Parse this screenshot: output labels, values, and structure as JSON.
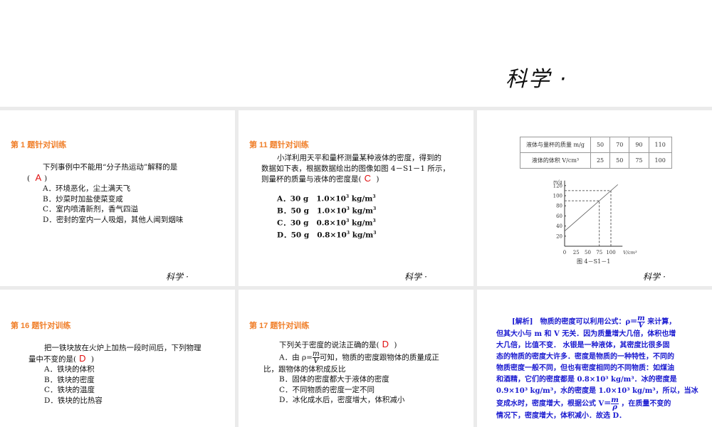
{
  "header": {
    "brand": "科学 ·"
  },
  "footer_brand": "科学 ·",
  "q1": {
    "title": "第 1 题针对训练",
    "stem": "下列事例中不能用“分子热运动”解释的是",
    "answer": "A",
    "options": [
      "A．环境恶化，尘土满天飞",
      "B．炒菜时加盐使菜变咸",
      "C．室内喷清新剂，香气四溢",
      "D．密封的室内一人吸烟，其他人闻到烟味"
    ]
  },
  "q11": {
    "title": "第 11 题针对训练",
    "stem1": "小洋利用天平和量杯测量某种液体的密度，得到的",
    "stem2": "数据如下表，根据数据绘出的图像如图 4－S1－1 所示，",
    "stem3": "则量杯的质量与液体的密度是(",
    "answer": "C",
    "close": ")",
    "options": [
      {
        "label": "A．30 g",
        "val": "1.0×10",
        "unit": "kg/m"
      },
      {
        "label": "B．50 g",
        "val": "1.0×10",
        "unit": "kg/m"
      },
      {
        "label": "C．30 g",
        "val": "0.8×10",
        "unit": "kg/m"
      },
      {
        "label": "D．50 g",
        "val": "0.8×10",
        "unit": "kg/m"
      }
    ],
    "exp": "3"
  },
  "table": {
    "row1_label": "液体与量杯的质量 m/g",
    "row1": [
      "50",
      "70",
      "90",
      "110"
    ],
    "row2_label": "液体的体积 V/cm³",
    "row2": [
      "25",
      "50",
      "75",
      "100"
    ]
  },
  "chart_data": {
    "type": "line",
    "caption": "图 4－S1－1",
    "xlabel": "V/cm³",
    "ylabel": "m/g",
    "x_ticks": [
      "0",
      "25",
      "50",
      "75",
      "100"
    ],
    "y_ticks": [
      "20",
      "40",
      "60",
      "80",
      "100",
      "120"
    ],
    "xlim": [
      0,
      125
    ],
    "ylim": [
      0,
      130
    ],
    "line": {
      "x": [
        0,
        115
      ],
      "y": [
        30,
        122
      ]
    },
    "guides": [
      {
        "x": 75,
        "y": 90
      },
      {
        "x": 100,
        "y": 110
      }
    ]
  },
  "q16": {
    "title": "第 16 题针对训练",
    "stem1": "把一铁块放在火炉上加热一段时间后，下列物理",
    "stem2": "量中不变的是(",
    "answer": "D",
    "close": ")",
    "options": [
      "A．铁块的体积",
      "B．铁块的密度",
      "C．铁块的温度",
      "D．铁块的比热容"
    ]
  },
  "q17": {
    "title": "第 17 题针对训练",
    "stem": "下列关于密度的说法正确的是(",
    "answer": "D",
    "close": ")",
    "optA1": "A．由 ρ=",
    "frac_num": "m",
    "frac_den": "V",
    "optA2": "可知，物质的密度跟物体的质量成正",
    "optA3": "比，跟物体的体积成反比",
    "options": [
      "B．固体的密度都大于液体的密度",
      "C．不同物质的密度一定不同",
      "D．冰化成水后，密度增大，体积减小"
    ]
  },
  "analysis": {
    "l1a": "[解析]　物质的密度可以利用公式：ρ＝",
    "l1b": "来计算，",
    "l2": "但其大小与 m 和 V 无关．因为质量增大几倍，体积也增",
    "l3": "大几倍，比值不变． 水银是一种液体，其密度比很多固",
    "l4": "态的物质的密度大许多．密度是物质的一种特性，不同的",
    "l5": "物质密度一般不同，但也有密度相同的不同物质：如煤油",
    "l6": "和酒精，它们的密度都是 0.8×10³ kg/m³．冰的密度是",
    "l7": "0.9×10³ kg/m³，水的密度是 1.0×10³ kg/m³，所以，当冰",
    "l8a": "变成水时，密度增大，根据公式 V＝",
    "l8b": "，在质量不变的",
    "l9": "情况下，密度增大，体积减小．故选 D．",
    "m": "m",
    "V": "V",
    "rho": "ρ"
  }
}
